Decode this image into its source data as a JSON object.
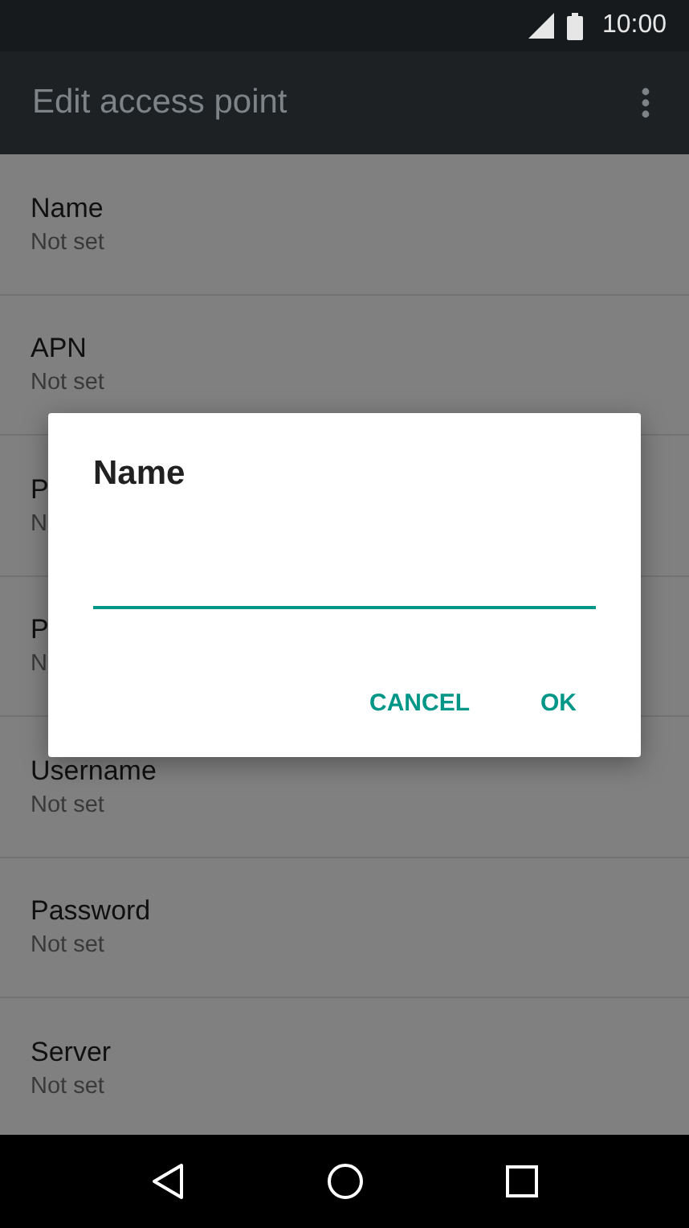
{
  "status_bar": {
    "time": "10:00"
  },
  "app_bar": {
    "title": "Edit access point"
  },
  "settings": [
    {
      "title": "Name",
      "value": "Not set"
    },
    {
      "title": "APN",
      "value": "Not set"
    },
    {
      "title": "P",
      "value": "N"
    },
    {
      "title": "P",
      "value": "N"
    },
    {
      "title": "Username",
      "value": "Not set"
    },
    {
      "title": "Password",
      "value": "Not set"
    },
    {
      "title": "Server",
      "value": "Not set"
    }
  ],
  "dialog": {
    "title": "Name",
    "field": {
      "focused": true
    },
    "buttons": [
      "CANCEL",
      "OK"
    ]
  }
}
